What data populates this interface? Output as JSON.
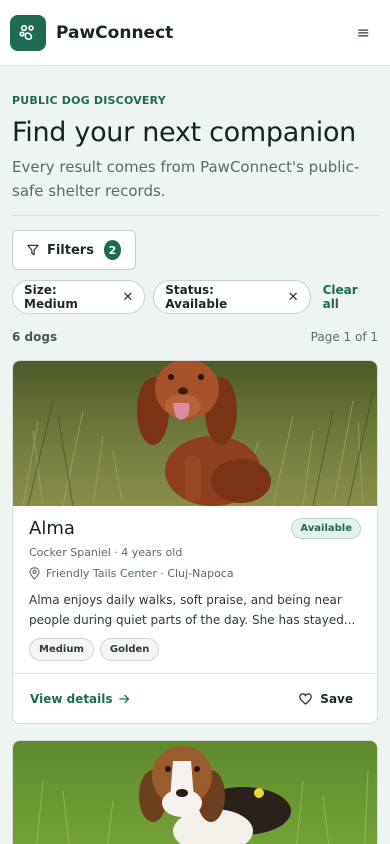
{
  "app": {
    "brand": "PawConnect",
    "logo_icon": "paw-icon",
    "menu_icon": "≡"
  },
  "hero": {
    "eyebrow": "PUBLIC DOG DISCOVERY",
    "title": "Find your next companion",
    "subtitle": "Every result comes from PawConnect's public-safe shelter records."
  },
  "filters": {
    "button_label": "Filters",
    "count": "2",
    "chips": [
      {
        "label": "Size: Medium",
        "remove": "✕"
      },
      {
        "label": "Status: Available",
        "remove": "✕"
      }
    ],
    "clear_all": "Clear all"
  },
  "results": {
    "count_label": "6 dogs",
    "page_label": "Page 1 of 1"
  },
  "dogs": [
    {
      "name": "Alma",
      "status": "Available",
      "breed_age": "Cocker Spaniel · 4 years old",
      "location": "Friendly Tails Center · Cluj-Napoca",
      "description": "Alma enjoys daily walks, soft praise, and being near people during quiet parts of the day. She has stayed...",
      "tags": [
        "Medium",
        "Golden"
      ],
      "view_label": "View details",
      "save_label": "Save"
    }
  ],
  "colors": {
    "accent": "#1e6a52",
    "background": "#eef4ef"
  }
}
